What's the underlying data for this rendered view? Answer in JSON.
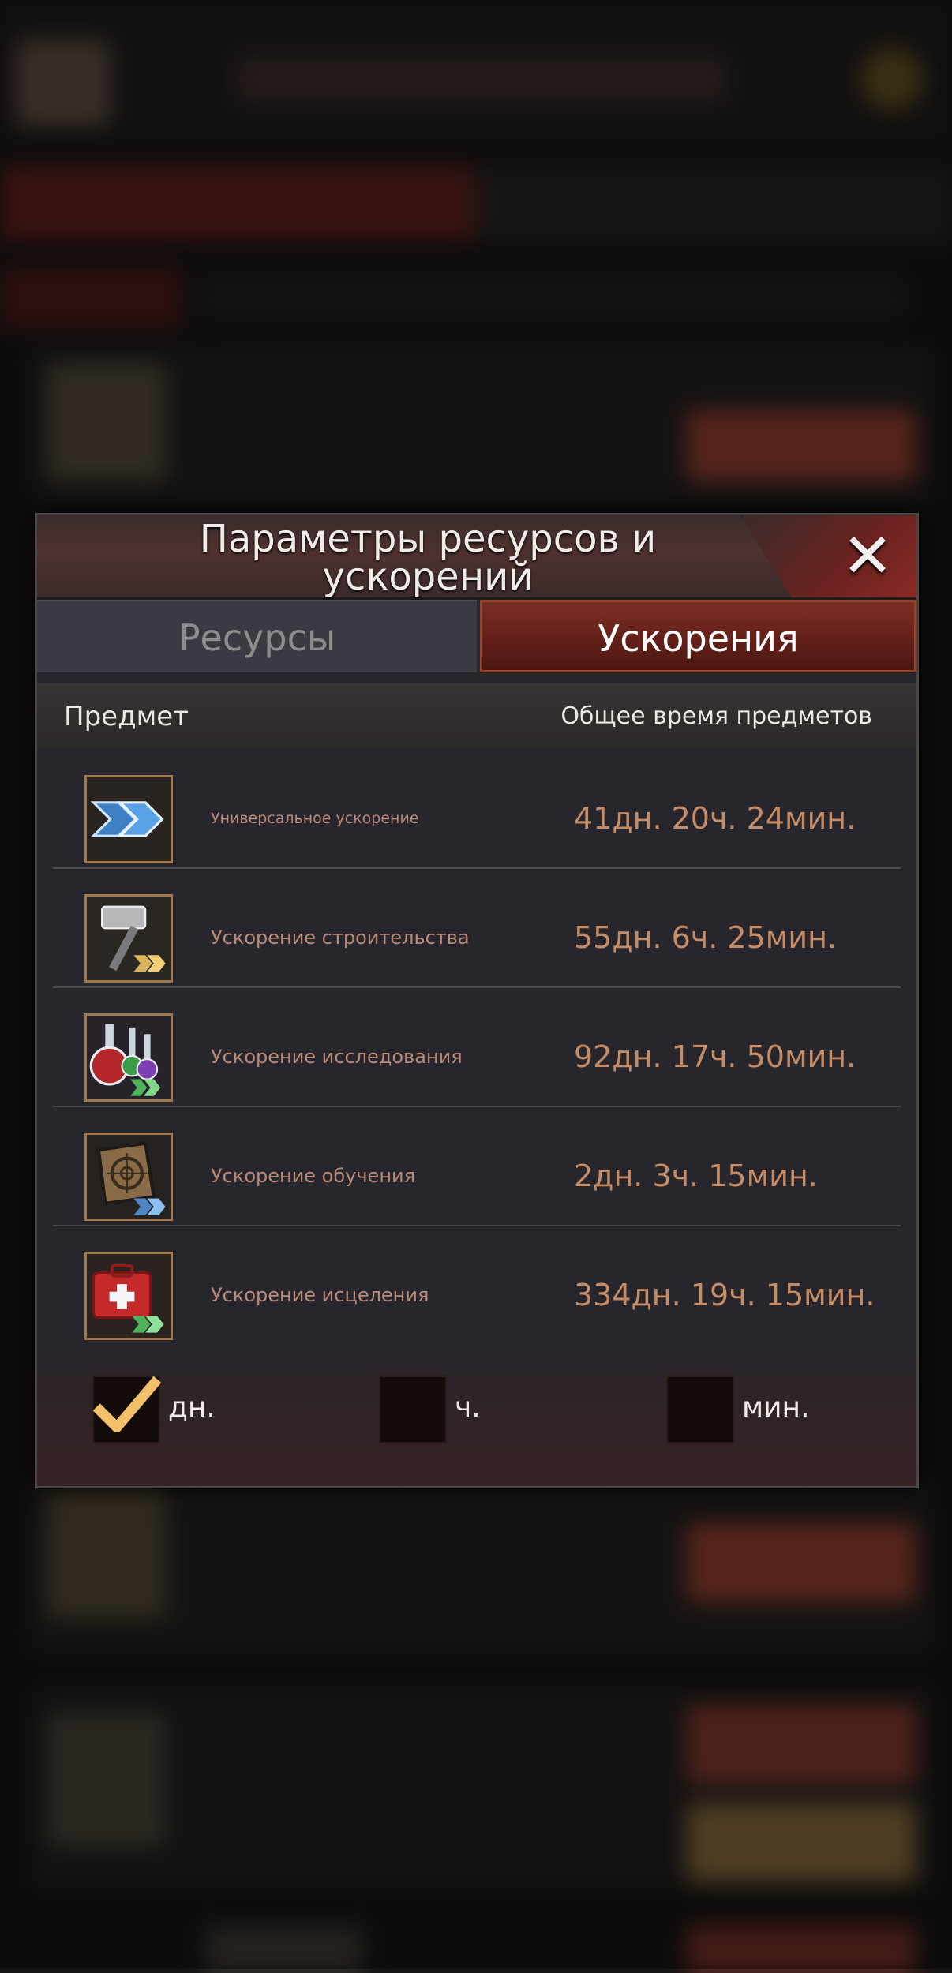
{
  "dialog": {
    "title": "Параметры ресурсов и ускорений",
    "close_icon": "close-icon",
    "tabs": [
      {
        "label": "Ресурсы",
        "active": false
      },
      {
        "label": "Ускорения",
        "active": true
      }
    ],
    "columns": {
      "item": "Предмет",
      "total_time": "Общее время предметов"
    },
    "items": [
      {
        "name": "Универсальное ускорение",
        "time": "41дн. 20ч. 24мин.",
        "icon": "universal-speedup-icon"
      },
      {
        "name": "Ускорение строительства",
        "time": "55дн. 6ч. 25мин.",
        "icon": "building-speedup-icon"
      },
      {
        "name": "Ускорение исследования",
        "time": "92дн. 17ч. 50мин.",
        "icon": "research-speedup-icon"
      },
      {
        "name": "Ускорение обучения",
        "time": "2дн. 3ч. 15мин.",
        "icon": "training-speedup-icon"
      },
      {
        "name": "Ускорение исцеления",
        "time": "334дн. 19ч. 15мин.",
        "icon": "healing-speedup-icon"
      }
    ],
    "units": [
      {
        "label": "дн.",
        "checked": true
      },
      {
        "label": "ч.",
        "checked": false
      },
      {
        "label": "мин.",
        "checked": false
      }
    ]
  },
  "colors": {
    "accent": "#7a2f24",
    "time_text": "#c58c66",
    "item_text": "#b9897a",
    "check": "#f2c06a"
  }
}
